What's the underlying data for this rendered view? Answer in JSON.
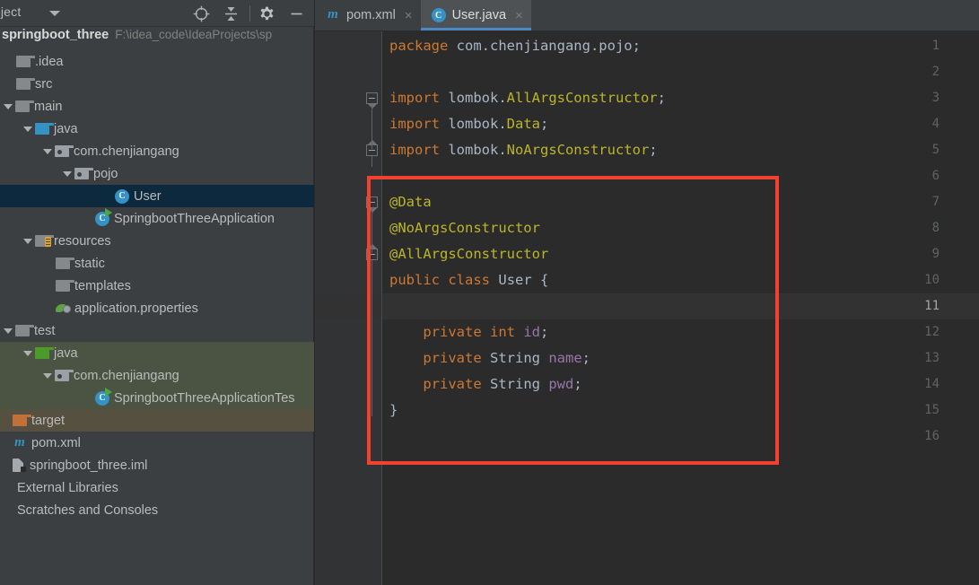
{
  "tool_window": {
    "title": "roject",
    "caret_icon": "chevron-down-icon",
    "actions": [
      {
        "name": "locate-icon",
        "glyph": "target"
      },
      {
        "name": "collapse-all-icon",
        "glyph": "collapse"
      },
      {
        "name": "settings-gear-icon",
        "glyph": "gear"
      },
      {
        "name": "hide-window-icon",
        "glyph": "minus"
      }
    ]
  },
  "project": {
    "name": "springboot_three",
    "path": "F:\\idea_code\\IdeaProjects\\sp",
    "tree": [
      {
        "label": ".idea",
        "indent": 0,
        "arrow": "none",
        "icon": "folder-grey",
        "state": "normal"
      },
      {
        "label": "src",
        "indent": 0,
        "arrow": "none",
        "icon": "folder-grey",
        "state": "normal"
      },
      {
        "label": "main",
        "indent": 0,
        "arrow": "down",
        "icon": "folder-grey",
        "state": "normal"
      },
      {
        "label": "java",
        "indent": 1,
        "arrow": "down",
        "icon": "folder-blue",
        "state": "normal"
      },
      {
        "label": "com.chenjiangang",
        "indent": 2,
        "arrow": "down",
        "icon": "folder-package",
        "state": "normal"
      },
      {
        "label": "pojo",
        "indent": 3,
        "arrow": "down",
        "icon": "folder-package",
        "state": "normal"
      },
      {
        "label": "User",
        "indent": 5,
        "arrow": "none",
        "icon": "class",
        "state": "selected"
      },
      {
        "label": "SpringbootThreeApplication",
        "indent": 4,
        "arrow": "none",
        "icon": "class-run",
        "state": "normal"
      },
      {
        "label": "resources",
        "indent": 1,
        "arrow": "down",
        "icon": "folder-resources",
        "state": "normal"
      },
      {
        "label": "static",
        "indent": 2,
        "arrow": "none",
        "icon": "folder-grey",
        "state": "normal"
      },
      {
        "label": "templates",
        "indent": 2,
        "arrow": "none",
        "icon": "folder-grey",
        "state": "normal"
      },
      {
        "label": "application.properties",
        "indent": 2,
        "arrow": "none",
        "icon": "properties",
        "state": "normal"
      },
      {
        "label": "test",
        "indent": 0,
        "arrow": "down",
        "icon": "folder-grey",
        "state": "normal"
      },
      {
        "label": "java",
        "indent": 1,
        "arrow": "down",
        "icon": "folder-green",
        "state": "testroot"
      },
      {
        "label": "com.chenjiangang",
        "indent": 2,
        "arrow": "down",
        "icon": "folder-package",
        "state": "testroot"
      },
      {
        "label": "SpringbootThreeApplicationTes",
        "indent": 4,
        "arrow": "none",
        "icon": "class-run",
        "state": "testroot"
      },
      {
        "label": "target",
        "indent": -1,
        "arrow": "none",
        "icon": "folder-orange",
        "state": "excluded"
      },
      {
        "label": "pom.xml",
        "indent": -1,
        "arrow": "none",
        "icon": "maven",
        "state": "normal"
      },
      {
        "label": "springboot_three.iml",
        "indent": -1,
        "arrow": "none",
        "icon": "iml",
        "state": "normal"
      },
      {
        "label": "External Libraries",
        "indent": -1,
        "arrow": "none",
        "icon": "none",
        "state": "normal"
      },
      {
        "label": "Scratches and Consoles",
        "indent": -1,
        "arrow": "none",
        "icon": "none",
        "state": "normal"
      }
    ]
  },
  "editor": {
    "tabs": [
      {
        "label": "pom.xml",
        "icon": "maven-icon",
        "active": false,
        "close": "×"
      },
      {
        "label": "User.java",
        "icon": "class-icon",
        "active": true,
        "close": "×"
      }
    ],
    "current_line": 11,
    "line_numbers": [
      1,
      2,
      3,
      4,
      5,
      6,
      7,
      8,
      9,
      10,
      11,
      12,
      13,
      14,
      15,
      16
    ],
    "lines": [
      {
        "n": 1,
        "tokens": [
          {
            "t": "package",
            "c": "kw"
          },
          {
            "t": " com.chenjiangang.pojo;",
            "c": "plain"
          }
        ]
      },
      {
        "n": 2,
        "tokens": []
      },
      {
        "n": 3,
        "tokens": [
          {
            "t": "import",
            "c": "kw"
          },
          {
            "t": " lombok.",
            "c": "plain"
          },
          {
            "t": "AllArgsConstructor",
            "c": "ann"
          },
          {
            "t": ";",
            "c": "plain"
          }
        ]
      },
      {
        "n": 4,
        "tokens": [
          {
            "t": "import",
            "c": "kw"
          },
          {
            "t": " lombok.",
            "c": "plain"
          },
          {
            "t": "Data",
            "c": "ann"
          },
          {
            "t": ";",
            "c": "plain"
          }
        ]
      },
      {
        "n": 5,
        "tokens": [
          {
            "t": "import",
            "c": "kw"
          },
          {
            "t": " lombok.",
            "c": "plain"
          },
          {
            "t": "NoArgsConstructor",
            "c": "ann"
          },
          {
            "t": ";",
            "c": "plain"
          }
        ]
      },
      {
        "n": 6,
        "tokens": []
      },
      {
        "n": 7,
        "tokens": [
          {
            "t": "@Data",
            "c": "ann"
          }
        ]
      },
      {
        "n": 8,
        "tokens": [
          {
            "t": "@NoArgsConstructor",
            "c": "ann"
          }
        ]
      },
      {
        "n": 9,
        "tokens": [
          {
            "t": "@AllArgsConstructor",
            "c": "ann"
          }
        ]
      },
      {
        "n": 10,
        "tokens": [
          {
            "t": "public",
            "c": "kw"
          },
          {
            "t": " ",
            "c": "plain"
          },
          {
            "t": "class",
            "c": "kw"
          },
          {
            "t": " ",
            "c": "plain"
          },
          {
            "t": "User",
            "c": "cname"
          },
          {
            "t": " {",
            "c": "plain"
          }
        ]
      },
      {
        "n": 11,
        "tokens": []
      },
      {
        "n": 12,
        "tokens": [
          {
            "t": "    ",
            "c": "plain"
          },
          {
            "t": "private",
            "c": "kw"
          },
          {
            "t": " ",
            "c": "plain"
          },
          {
            "t": "int",
            "c": "kw"
          },
          {
            "t": " ",
            "c": "plain"
          },
          {
            "t": "id",
            "c": "fld"
          },
          {
            "t": ";",
            "c": "plain"
          }
        ]
      },
      {
        "n": 13,
        "tokens": [
          {
            "t": "    ",
            "c": "plain"
          },
          {
            "t": "private",
            "c": "kw"
          },
          {
            "t": " ",
            "c": "plain"
          },
          {
            "t": "String",
            "c": "type"
          },
          {
            "t": " ",
            "c": "plain"
          },
          {
            "t": "name",
            "c": "fld"
          },
          {
            "t": ";",
            "c": "plain"
          }
        ]
      },
      {
        "n": 14,
        "tokens": [
          {
            "t": "    ",
            "c": "plain"
          },
          {
            "t": "private",
            "c": "kw"
          },
          {
            "t": " ",
            "c": "plain"
          },
          {
            "t": "String",
            "c": "type"
          },
          {
            "t": " ",
            "c": "plain"
          },
          {
            "t": "pwd",
            "c": "fld"
          },
          {
            "t": ";",
            "c": "plain"
          }
        ]
      },
      {
        "n": 15,
        "tokens": [
          {
            "t": "}",
            "c": "plain"
          }
        ]
      },
      {
        "n": 16,
        "tokens": []
      }
    ],
    "fold_markers": [
      {
        "line": 3,
        "dir": "down"
      },
      {
        "line": 5,
        "dir": "up"
      },
      {
        "line": 7,
        "dir": "down"
      },
      {
        "line": 9,
        "dir": "up"
      }
    ]
  },
  "annotation": {
    "name": "red-highlight-rectangle",
    "color": "#F4402F"
  },
  "colors": {
    "background": "#2B2B2B",
    "panel": "#3C3F41",
    "gutter": "#313335",
    "selection": "#0D293E",
    "test_root": "#4B5343",
    "excluded": "#55503F",
    "tab_active_underline": "#4A88C7",
    "keyword": "#CC7832",
    "annotation": "#BBB529",
    "field": "#9876AA",
    "identifier": "#A9B7C6"
  }
}
